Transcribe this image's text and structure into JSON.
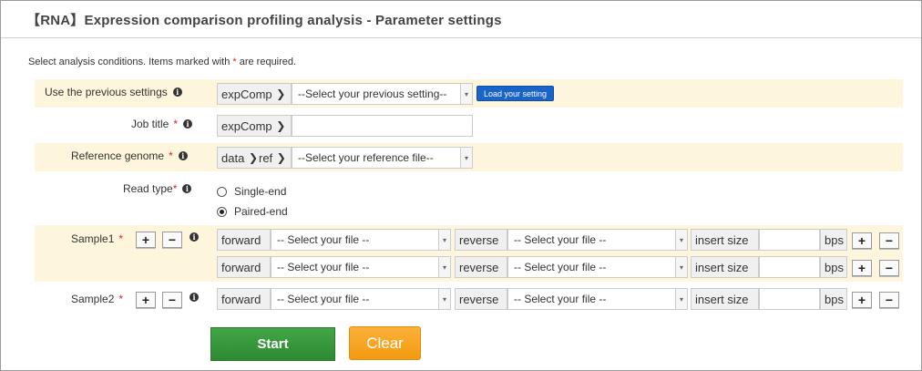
{
  "page": {
    "title": "【RNA】Expression comparison profiling analysis - Parameter settings",
    "instruction_pre": "Select analysis conditions. Items marked with ",
    "required_mark": "*",
    "instruction_post": " are required.",
    "info_glyph": "i"
  },
  "previous": {
    "label": "Use the previous settings",
    "prefix": "expComp",
    "select_value": "--Select your previous setting--",
    "load_label": "Load your setting"
  },
  "job": {
    "label": "Job title",
    "prefix": "expComp",
    "value": ""
  },
  "reference": {
    "label": "Reference genome",
    "prefix_a": "data",
    "prefix_b": "ref",
    "select_value": "--Select your reference file--"
  },
  "read_type": {
    "label": "Read type",
    "options": [
      {
        "label": "Single-end",
        "selected": false
      },
      {
        "label": "Paired-end",
        "selected": true
      }
    ]
  },
  "common": {
    "chevron": "❯",
    "forward": "forward",
    "reverse": "reverse",
    "file_placeholder": "-- Select your file --",
    "insert_size": "insert size",
    "bps": "bps",
    "plus": "+",
    "minus": "−"
  },
  "samples": [
    {
      "label": "Sample1"
    },
    {
      "label": "Sample2"
    }
  ],
  "actions": {
    "start": "Start",
    "clear": "Clear"
  },
  "colors": {
    "band": "#fdf6dc",
    "required": "#e02020",
    "load_button": "#1a63c8",
    "start_button": "#3a9a3e",
    "clear_button": "#f5a623"
  }
}
